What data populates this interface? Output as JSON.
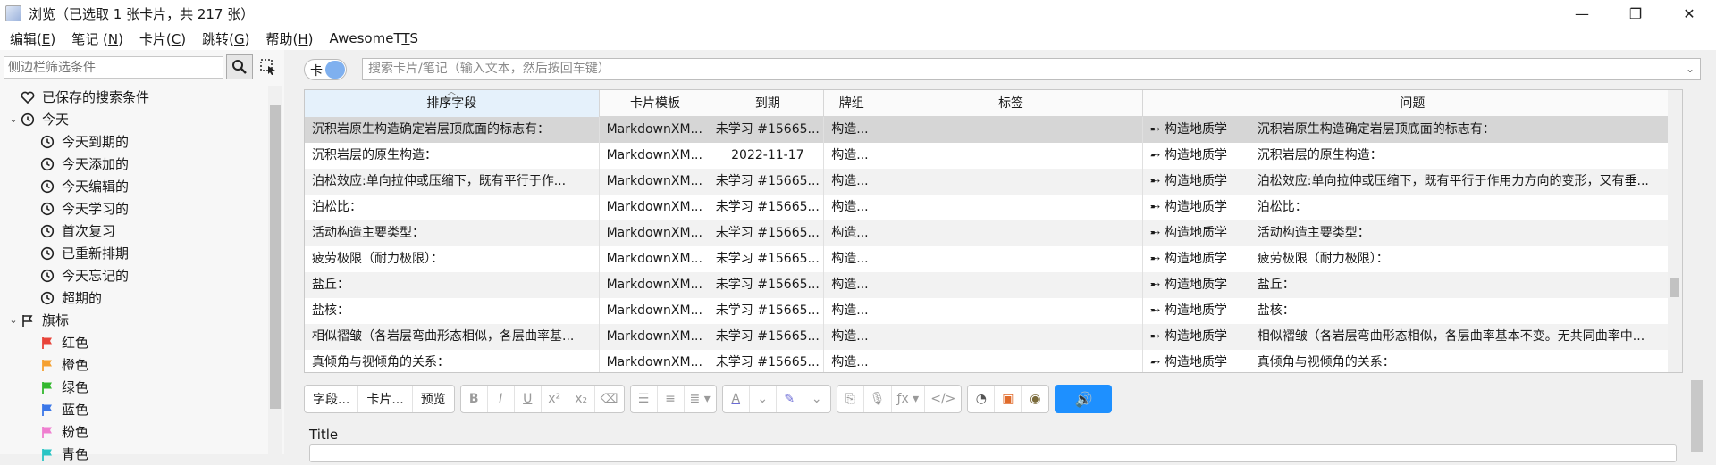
{
  "window": {
    "title": "浏览（已选取 1 张卡片，共 217 张）",
    "controls": {
      "minimize": "—",
      "maximize": "❐",
      "close": "✕"
    }
  },
  "menu": [
    {
      "label": "编辑(",
      "key": "E",
      "end": ")"
    },
    {
      "label": "笔记 (",
      "key": "N",
      "end": ")"
    },
    {
      "label": "卡片(",
      "key": "C",
      "end": ")"
    },
    {
      "label": "跳转(",
      "key": "G",
      "end": ")"
    },
    {
      "label": "帮助(",
      "key": "H",
      "end": ")"
    },
    {
      "label": "AwesomeT",
      "key": "T",
      "end": "S"
    }
  ],
  "sidebar": {
    "filter_placeholder": "侧边栏筛选条件",
    "items": [
      {
        "label": "已保存的搜索条件",
        "icon": "heart-icon",
        "level": 0,
        "arrow": ""
      },
      {
        "label": "今天",
        "icon": "clock-icon",
        "level": 0,
        "arrow": "⌄"
      },
      {
        "label": "今天到期的",
        "icon": "clock-icon",
        "level": 1
      },
      {
        "label": "今天添加的",
        "icon": "clock-icon",
        "level": 1
      },
      {
        "label": "今天编辑的",
        "icon": "clock-icon",
        "level": 1
      },
      {
        "label": "今天学习的",
        "icon": "clock-icon",
        "level": 1
      },
      {
        "label": "首次复习",
        "icon": "clock-icon",
        "level": 1
      },
      {
        "label": "已重新排期",
        "icon": "clock-icon",
        "level": 1
      },
      {
        "label": "今天忘记的",
        "icon": "clock-icon",
        "level": 1
      },
      {
        "label": "超期的",
        "icon": "clock-icon",
        "level": 1
      },
      {
        "label": "旗标",
        "icon": "flag-outline-icon",
        "level": 0,
        "arrow": "⌄"
      },
      {
        "label": "红色",
        "icon": "flag-icon",
        "color": "#e8443a",
        "level": 1
      },
      {
        "label": "橙色",
        "icon": "flag-icon",
        "color": "#f5a030",
        "level": 1
      },
      {
        "label": "绿色",
        "icon": "flag-icon",
        "color": "#33b82e",
        "level": 1
      },
      {
        "label": "蓝色",
        "icon": "flag-icon",
        "color": "#3b77e8",
        "level": 1
      },
      {
        "label": "粉色",
        "icon": "flag-icon",
        "color": "#ef7fd0",
        "level": 1
      },
      {
        "label": "青色",
        "icon": "flag-icon",
        "color": "#29c4c4",
        "level": 1
      }
    ]
  },
  "search": {
    "toggle_label": "卡",
    "placeholder": "搜索卡片/笔记（输入文本，然后按回车键）"
  },
  "table": {
    "columns": [
      "排序字段",
      "卡片模板",
      "到期",
      "牌组",
      "标签",
      "问题"
    ],
    "sorted_column": 0,
    "rows": [
      {
        "sort": "沉积岩原生构造确定岩层顶底面的标志有：",
        "template": "MarkdownXM...",
        "due": "未学习 #15665...",
        "deck": "构造...",
        "tags": "",
        "deck_tag": "➸ 构造地质学",
        "question": "沉积岩原生构造确定岩层顶底面的标志有："
      },
      {
        "sort": "沉积岩层的原生构造：",
        "template": "MarkdownXM...",
        "due": "2022-11-17",
        "deck": "构造...",
        "tags": "",
        "deck_tag": "➸ 构造地质学",
        "question": "沉积岩层的原生构造："
      },
      {
        "sort": "泊松效应:单向拉伸或压缩下，既有平行于作...",
        "template": "MarkdownXM...",
        "due": "未学习 #15665...",
        "deck": "构造...",
        "tags": "",
        "deck_tag": "➸ 构造地质学",
        "question": "泊松效应:单向拉伸或压缩下，既有平行于作用力方向的变形，又有垂..."
      },
      {
        "sort": "泊松比：",
        "template": "MarkdownXM...",
        "due": "未学习 #15665...",
        "deck": "构造...",
        "tags": "",
        "deck_tag": "➸ 构造地质学",
        "question": "泊松比："
      },
      {
        "sort": "活动构造主要类型：",
        "template": "MarkdownXM...",
        "due": "未学习 #15665...",
        "deck": "构造...",
        "tags": "",
        "deck_tag": "➸ 构造地质学",
        "question": "活动构造主要类型："
      },
      {
        "sort": "疲劳极限（耐力极限）：",
        "template": "MarkdownXM...",
        "due": "未学习 #15665...",
        "deck": "构造...",
        "tags": "",
        "deck_tag": "➸ 构造地质学",
        "question": "疲劳极限（耐力极限）："
      },
      {
        "sort": "盐丘：",
        "template": "MarkdownXM...",
        "due": "未学习 #15665...",
        "deck": "构造...",
        "tags": "",
        "deck_tag": "➸ 构造地质学",
        "question": "盐丘："
      },
      {
        "sort": "盐核：",
        "template": "MarkdownXM...",
        "due": "未学习 #15665...",
        "deck": "构造...",
        "tags": "",
        "deck_tag": "➸ 构造地质学",
        "question": "盐核："
      },
      {
        "sort": "相似褶皱（各岩层弯曲形态相似，各层曲率基...",
        "template": "MarkdownXM...",
        "due": "未学习 #15665...",
        "deck": "构造...",
        "tags": "",
        "deck_tag": "➸ 构造地质学",
        "question": "相似褶皱（各岩层弯曲形态相似，各层曲率基本不变。无共同曲率中..."
      },
      {
        "sort": "真倾角与视倾角的关系：",
        "template": "MarkdownXM...",
        "due": "未学习 #15665...",
        "deck": "构造...",
        "tags": "",
        "deck_tag": "➸ 构造地质学",
        "question": "真倾角与视倾角的关系："
      }
    ]
  },
  "editor": {
    "field_btn": "字段...",
    "cards_btn": "卡片...",
    "preview_btn": "预览",
    "field_title": "Title"
  }
}
